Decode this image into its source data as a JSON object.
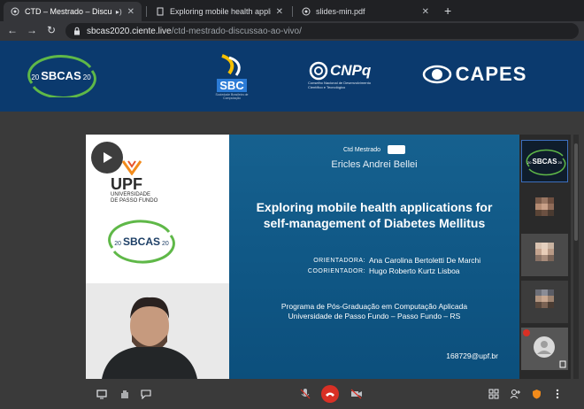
{
  "tabs": [
    {
      "title": "CTD – Mestrado – Discussão",
      "active": true,
      "audio": true
    },
    {
      "title": "Exploring mobile health applicatio",
      "active": false
    },
    {
      "title": "slides-min.pdf",
      "active": false
    }
  ],
  "address": {
    "host": "sbcas2020.ciente.live",
    "path": "/ctd-mestrado-discussao-ao-vivo/"
  },
  "banner": {
    "sbcas": {
      "left_num": "20",
      "name": "SBCAS",
      "right_num": "20"
    },
    "sbc": {
      "name": "SBC",
      "caption": "Sociedade Brasileira de Computação"
    },
    "cnpq": {
      "name": "CNPq",
      "caption": "Conselho Nacional de Desenvolvimento Científico e Tecnológico"
    },
    "capes": {
      "name": "CAPES"
    }
  },
  "slide": {
    "panel": {
      "upf_name": "UPF",
      "upf_line1": "UNIVERSIDADE",
      "upf_line2": "DE PASSO FUNDO",
      "sbcas_left": "20",
      "sbcas_name": "SBCAS",
      "sbcas_right": "20"
    },
    "room_label": "Ctd Mestrado",
    "student": "Ericles Andrei Bellei",
    "title_line1": "Exploring mobile health applications for",
    "title_line2": "self-management of Diabetes Mellitus",
    "advisor_label": "ORIENTADORA:",
    "advisor": "Ana Carolina Bertoletti De Marchi",
    "coadvisor_label": "COORIENTADOR:",
    "coadvisor": "Hugo Roberto Kurtz Lisboa",
    "program_line1": "Programa de Pós-Graduação em Computação Aplicada",
    "program_line2": "Universidade de Passo Fundo – Passo Fundo – RS",
    "email": "168729@upf.br"
  },
  "thumbnails": {
    "first": {
      "left_num": "20",
      "name": "SBCAS",
      "right_num": "20"
    }
  },
  "colors": {
    "banner": "#0b3a6e",
    "slide": "#0f5684",
    "end_call": "#d93025",
    "accent_orange": "#f28b1b"
  }
}
